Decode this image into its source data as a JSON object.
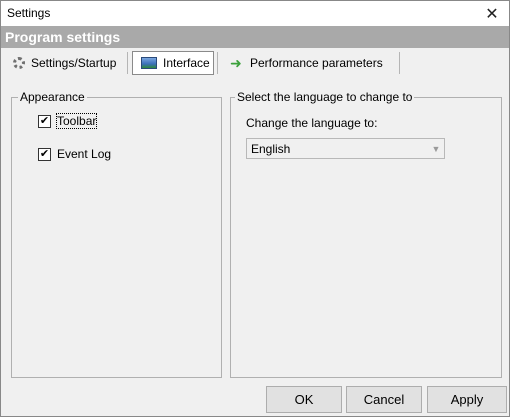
{
  "window": {
    "title": "Settings"
  },
  "header": {
    "title": "Program settings"
  },
  "tabs": [
    {
      "label": "Settings/Startup",
      "icon": "gear-icon",
      "active": false
    },
    {
      "label": "Interface",
      "icon": "monitor-icon",
      "active": true
    },
    {
      "label": "Performance parameters",
      "icon": "green-arrow-icon",
      "active": false
    }
  ],
  "appearance": {
    "legend": "Appearance",
    "options": [
      {
        "label": "Toolbar",
        "checked": true
      },
      {
        "label": "Event Log",
        "checked": true
      }
    ]
  },
  "language": {
    "legend": "Select the language to change to",
    "label": "Change the language to:",
    "selected": "English"
  },
  "buttons": {
    "ok": "OK",
    "cancel": "Cancel",
    "apply": "Apply"
  },
  "icons": {
    "close": "close-icon",
    "dropdown": "chevron-down-icon",
    "check": "check-icon"
  }
}
